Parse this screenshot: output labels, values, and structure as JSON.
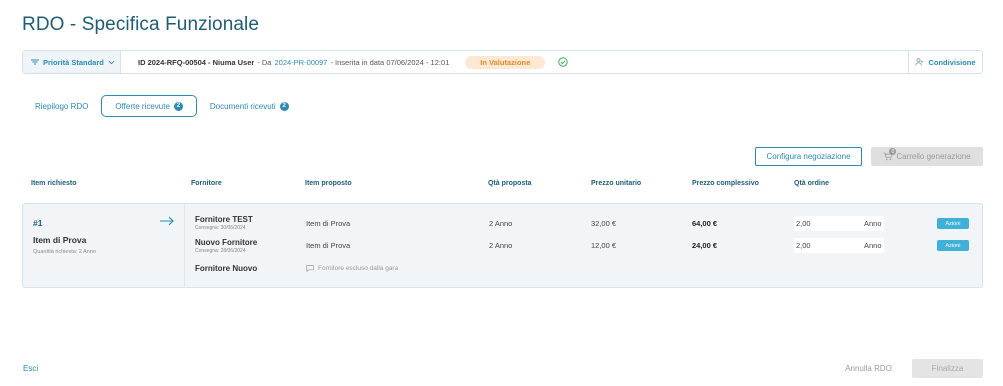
{
  "page": {
    "title": "RDO - Specifica Funzionale"
  },
  "info_bar": {
    "priority_label": "Priorità Standard",
    "id_text": "ID 2024-RFQ-00504 - Niuma User",
    "from_prefix": "- Da",
    "from_link": "2024-PR-00097",
    "inserted_text": "- Inserita in data 07/06/2024 - 12:01",
    "status": "In Valutazione",
    "share_label": "Condivisione"
  },
  "tabs": [
    {
      "label": "Riepilogo RDO"
    },
    {
      "label": "Offerte ricevute",
      "badge": "2"
    },
    {
      "label": "Documenti ricevuti",
      "badge": "2"
    }
  ],
  "toolbar": {
    "configure_label": "Configura negoziazione",
    "cart_label": "Carrello generazione",
    "cart_count": "0"
  },
  "table": {
    "headers": [
      "Item richiesto",
      "Fornitore",
      "Item proposto",
      "Qtà proposta",
      "Prezzo unitario",
      "Prezzo complessivo",
      "Qtà ordine"
    ],
    "requested_item": {
      "number": "#1",
      "name": "Item di Prova",
      "quantity": "Quantità richiesta: 2 Anno"
    },
    "offers": [
      {
        "supplier": "Fornitore TEST",
        "delivery": "Consegna: 30/06/2024",
        "item": "Item di Prova",
        "qty": "2 Anno",
        "unit_price": "32,00 €",
        "total_price": "64,00 €",
        "order_qty": "2,00",
        "order_unit": "Anno",
        "action_label": "Azioni"
      },
      {
        "supplier": "Nuovo Fornitore",
        "delivery": "Consegna: 28/06/2024",
        "item": "Item di Prova",
        "qty": "2 Anno",
        "unit_price": "12,00 €",
        "total_price": "24,00 €",
        "order_qty": "2,00",
        "order_unit": "Anno",
        "action_label": "Azioni"
      }
    ],
    "excluded": {
      "supplier": "Fornitore Nuovo",
      "note": "Fornitore escluso dalla gara"
    }
  },
  "footer": {
    "exit_label": "Esci",
    "cancel_label": "Annulla RDO",
    "finalize_label": "Finalizza"
  },
  "colors": {
    "primary": "#2a8bb5",
    "title": "#1d5d79",
    "status_bg": "#fde9d3",
    "status_text": "#e08a2c",
    "action": "#3fb1d8",
    "card_bg": "#f1f5f8"
  }
}
